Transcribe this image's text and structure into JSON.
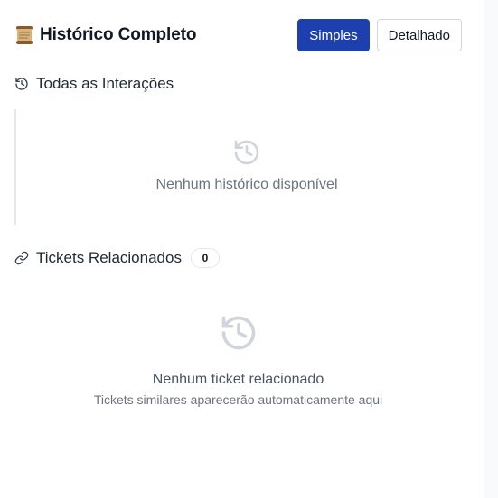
{
  "header": {
    "title": "Histórico Completo",
    "title_icon": "scroll-icon",
    "view_modes": [
      {
        "label": "Simples",
        "active": true
      },
      {
        "label": "Detalhado",
        "active": false
      }
    ]
  },
  "interactions_section": {
    "title": "Todas as Interações",
    "icon": "history-icon",
    "empty_icon": "history-icon",
    "empty_text": "Nenhum histórico disponível"
  },
  "related_section": {
    "title": "Tickets Relacionados",
    "icon": "link-icon",
    "count": "0",
    "empty_icon": "history-icon",
    "empty_text": "Nenhum ticket relacionado",
    "empty_subtext": "Tickets similares aparecerão automaticamente aqui"
  },
  "colors": {
    "primary": "#1e40af",
    "muted_icon": "#d1d5db",
    "text_muted": "#6b7280"
  }
}
